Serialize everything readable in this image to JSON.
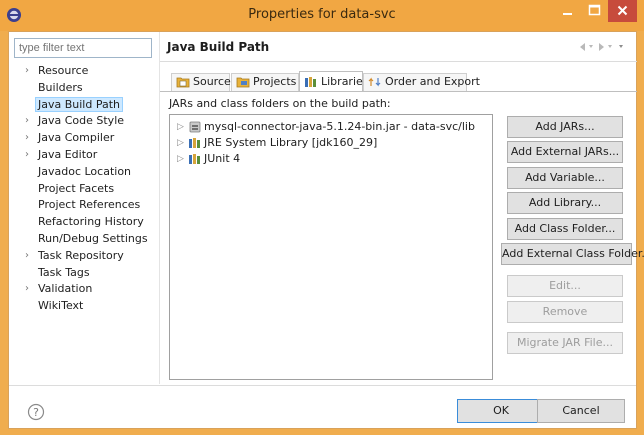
{
  "window": {
    "title": "Properties for data-svc",
    "controls": {
      "minimize": "minimize",
      "maximize": "maximize",
      "close": "close"
    },
    "accent": "#f1a743",
    "close_color": "#c74b3c"
  },
  "sidebar": {
    "filter_placeholder": "type filter text",
    "items": [
      {
        "label": "Resource",
        "expandable": true
      },
      {
        "label": "Builders",
        "expandable": false
      },
      {
        "label": "Java Build Path",
        "expandable": false,
        "selected": true
      },
      {
        "label": "Java Code Style",
        "expandable": true
      },
      {
        "label": "Java Compiler",
        "expandable": true
      },
      {
        "label": "Java Editor",
        "expandable": true
      },
      {
        "label": "Javadoc Location",
        "expandable": false
      },
      {
        "label": "Project Facets",
        "expandable": false
      },
      {
        "label": "Project References",
        "expandable": false
      },
      {
        "label": "Refactoring History",
        "expandable": false
      },
      {
        "label": "Run/Debug Settings",
        "expandable": false
      },
      {
        "label": "Task Repository",
        "expandable": true
      },
      {
        "label": "Task Tags",
        "expandable": false
      },
      {
        "label": "Validation",
        "expandable": true
      },
      {
        "label": "WikiText",
        "expandable": false
      }
    ]
  },
  "page": {
    "title": "Java Build Path",
    "tabs": [
      {
        "label": "Source",
        "icon": "source-folder-icon"
      },
      {
        "label": "Projects",
        "icon": "project-icon"
      },
      {
        "label": "Libraries",
        "icon": "library-icon",
        "active": true
      },
      {
        "label": "Order and Export",
        "icon": "order-export-icon"
      }
    ],
    "caption": "JARs and class folders on the build path:",
    "libraries": [
      {
        "label": "mysql-connector-java-5.1.24-bin.jar - data-svc/lib",
        "icon": "jar-icon"
      },
      {
        "label": "JRE System Library [jdk160_29]",
        "icon": "library-icon"
      },
      {
        "label": "JUnit 4",
        "icon": "library-icon"
      }
    ],
    "buttons": [
      {
        "label": "Add JARs...",
        "enabled": true
      },
      {
        "label": "Add External JARs...",
        "enabled": true
      },
      {
        "label": "Add Variable...",
        "enabled": true
      },
      {
        "label": "Add Library...",
        "enabled": true
      },
      {
        "label": "Add Class Folder...",
        "enabled": true
      },
      {
        "label": "Add External Class Folder...",
        "enabled": true
      },
      {
        "label": "Edit...",
        "enabled": false
      },
      {
        "label": "Remove",
        "enabled": false
      },
      {
        "label": "Migrate JAR File...",
        "enabled": false
      }
    ]
  },
  "footer": {
    "help_icon": "help-icon",
    "ok_label": "OK",
    "cancel_label": "Cancel"
  }
}
